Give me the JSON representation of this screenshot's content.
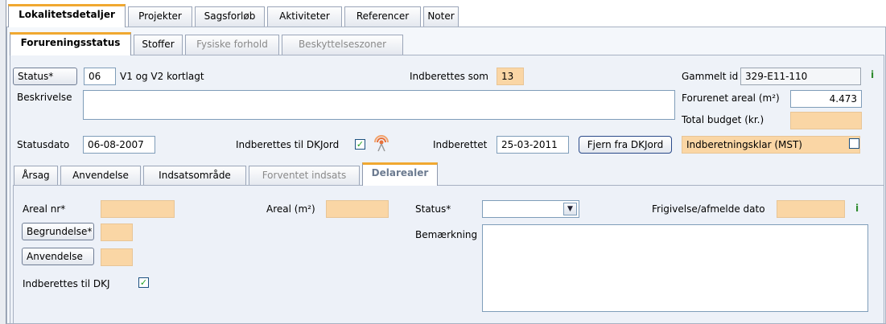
{
  "top_tabs": [
    "Lokalitetsdetaljer",
    "Projekter",
    "Sagsforløb",
    "Aktiviteter",
    "Referencer",
    "Noter"
  ],
  "sub_tabs": [
    "Forureningsstatus",
    "Stoffer",
    "Fysiske forhold",
    "Beskyttelseszoner"
  ],
  "status": {
    "button_label": "Status*",
    "code": "06",
    "text": "V1 og V2 kortlagt"
  },
  "indberettes_som": {
    "label": "Indberettes som",
    "value": "13"
  },
  "gammelt_id": {
    "label": "Gammelt id",
    "value": "329-E11-110",
    "info": "i"
  },
  "beskrivelse": {
    "label": "Beskrivelse",
    "value": ""
  },
  "forurenet_areal": {
    "label": "Forurenet areal (m²)",
    "value": "4.473"
  },
  "total_budget": {
    "label": "Total budget (kr.)",
    "value": ""
  },
  "statusdato": {
    "label": "Statusdato",
    "value": "06-08-2007"
  },
  "dkjord": {
    "label": "Indberettes til DKJord",
    "checked": "✓"
  },
  "indberettet": {
    "label": "Indberettet",
    "value": "25-03-2011",
    "button": "Fjern fra DKJord"
  },
  "indberetningsklar": {
    "label": "Indberetningsklar (MST)",
    "checked": ""
  },
  "bottom_tabs": [
    "Årsag",
    "Anvendelse",
    "Indsatsområde",
    "Forventet indsats",
    "Delarealer"
  ],
  "delarealer": {
    "areal_nr_label": "Areal nr*",
    "areal_label": "Areal (m²)",
    "status_label": "Status*",
    "status_value": "",
    "frigivelse_label": "Frigivelse/afmelde dato",
    "info": "i",
    "begrundelse_button": "Begrundelse*",
    "anvendelse_button": "Anvendelse",
    "bemaerkning_label": "Bemærkning",
    "indberettes_dkj_label": "Indberettes til DKJ",
    "indberettes_dkj_checked": "✓"
  },
  "colors": {
    "accent": "#f0a830",
    "field_orange": "#fad6a5",
    "panel": "#eef2f8"
  }
}
